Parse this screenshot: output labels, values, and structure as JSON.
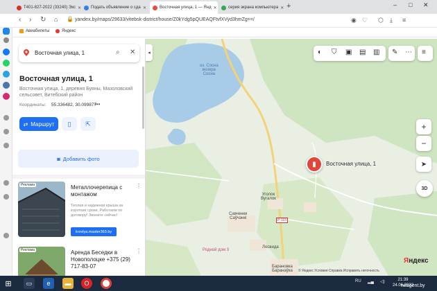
{
  "browser": {
    "tabs": [
      {
        "label": "T401-827-2022 (33240) Экс",
        "active": false,
        "favicon_color": "#d93025"
      },
      {
        "label": "Подать объявление о сда",
        "active": false,
        "favicon_color": "#2f80ed"
      },
      {
        "label": "Восточная улица, 1 — Янд",
        "active": true,
        "favicon_color": "#e74c3c"
      },
      {
        "label": "серия экрана компьютера",
        "active": false,
        "favicon_color": "#34a853"
      }
    ],
    "new_tab_symbol": "+",
    "window_controls": [
      "–",
      "□",
      "✕"
    ],
    "url": "yandex.by/maps/29633/vitebsk-district/house/Z0kYdg5pQUEAQFtvfXVyd3hmZg==/",
    "bookmarks": [
      {
        "label": "Авиабилеты",
        "color": "#f09a1a"
      },
      {
        "label": "Яндекс",
        "color": "#e33"
      }
    ]
  },
  "search": {
    "value": "Восточная улица, 1",
    "search_icon": "search-icon",
    "close_icon": "close-icon"
  },
  "place": {
    "title": "Восточная улица, 1",
    "address": "Восточная улица, 1, деревня Буяны, Мазоловский сельсовет, Витебский район",
    "coords_label": "Координаты:",
    "coords_value": "55.336482, 30.099877",
    "coords_more": "•••",
    "route_label": "Маршрут",
    "add_photo_label": "Добавить фото"
  },
  "ads": [
    {
      "badge": "Реклама",
      "title": "Металлочерепица с монтажом",
      "desc": "Теплая и надежная крыша за короткие сроки. Работаем по договору! Звоните сейчас!",
      "link": "krovlya.master365.by"
    },
    {
      "badge": "Реклама",
      "title": "Аренда Беседки в Новополоцке +375 (29) 717-83-07",
      "desc": "",
      "link": ""
    }
  ],
  "map": {
    "marker_label": "Восточная улица, 1",
    "labels": {
      "lake": "оз. Сосна\nвозера\nСосна",
      "village1": "Уголок\nВугалок",
      "village2": "Савченки\nСаўчэнкі",
      "village3": "Лосвида",
      "village4": "Родной дом 3",
      "village5": "Барановка\nБаранаўка",
      "road": "Р-115"
    },
    "logo_ya": "Я",
    "logo_rest": "ндекс",
    "copyright": "© Яндекс Условия Справка Исправить неточность",
    "zoom_in": "+",
    "zoom_out": "−",
    "three_d": "3D"
  },
  "taskbar": {
    "lang": "RU",
    "time": "21:39",
    "date": "24.06.2022",
    "watermark": "neagent.by"
  }
}
